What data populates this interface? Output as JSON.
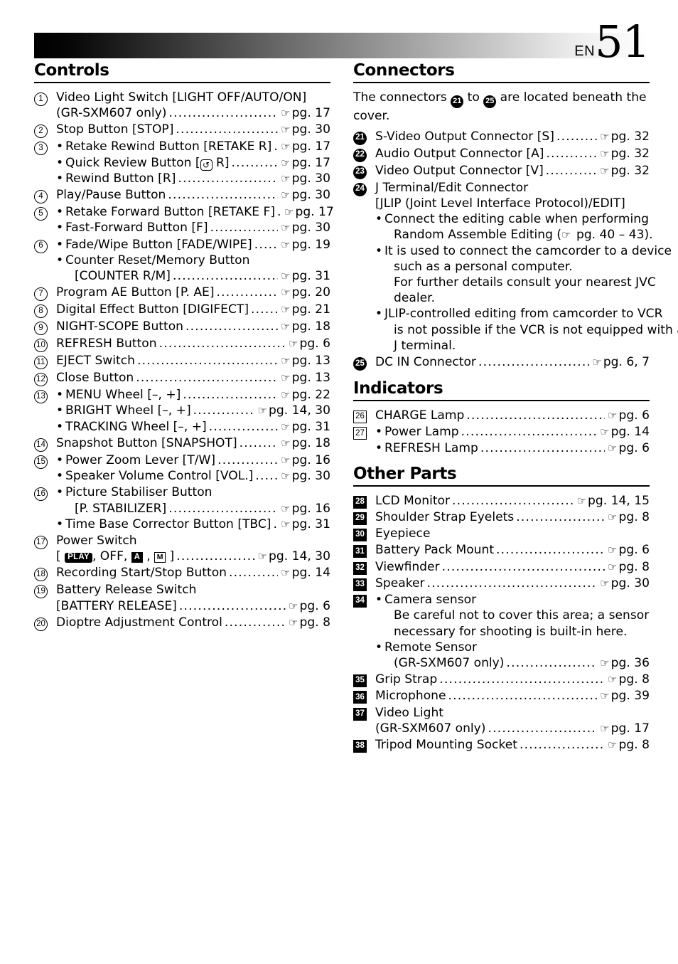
{
  "header": {
    "lang_code": "EN",
    "page_number": "51"
  },
  "icons": {
    "reference_hand": "☞",
    "bullet": "•",
    "quick_review": "↺"
  },
  "left_column": {
    "section_title": "Controls",
    "items": [
      {
        "marker": "1",
        "lines": [
          {
            "text": "Video Light Switch [LIGHT OFF/AUTO/ON]",
            "ref": ""
          },
          {
            "text": "(GR-SXM607 only)",
            "ref": "pg. 17"
          }
        ]
      },
      {
        "marker": "2",
        "lines": [
          {
            "text": "Stop Button [STOP]",
            "ref": "pg. 30"
          }
        ]
      },
      {
        "marker": "3",
        "lines": [
          {
            "bullet": true,
            "text": "Retake Rewind Button [RETAKE R]",
            "ref": "pg. 17"
          },
          {
            "bullet": true,
            "text": "Quick Review Button [",
            "text_after": " R]",
            "icon": "quick_review",
            "ref": "pg. 17"
          },
          {
            "bullet": true,
            "text": "Rewind Button [R]",
            "ref": "pg. 30"
          }
        ]
      },
      {
        "marker": "4",
        "lines": [
          {
            "text": "Play/Pause Button",
            "ref": "pg. 30"
          }
        ]
      },
      {
        "marker": "5",
        "lines": [
          {
            "bullet": true,
            "text": "Retake Forward Button [RETAKE F]",
            "ref": "pg. 17"
          },
          {
            "bullet": true,
            "text": "Fast-Forward Button [F]",
            "ref": "pg. 30"
          }
        ]
      },
      {
        "marker": "6",
        "lines": [
          {
            "bullet": true,
            "text": "Fade/Wipe Button [FADE/WIPE]",
            "ref": "pg. 19"
          },
          {
            "bullet": true,
            "text": "Counter Reset/Memory Button",
            "ref": ""
          },
          {
            "indent": 2,
            "text": "[COUNTER R/M]",
            "ref": "pg. 31"
          }
        ]
      },
      {
        "marker": "7",
        "lines": [
          {
            "text": "Program AE Button [P. AE]",
            "ref": "pg. 20"
          }
        ]
      },
      {
        "marker": "8",
        "lines": [
          {
            "text": "Digital Effect Button [DIGIFECT]",
            "ref": "pg. 21"
          }
        ]
      },
      {
        "marker": "9",
        "lines": [
          {
            "text": "NIGHT-SCOPE Button",
            "ref": "pg. 18"
          }
        ]
      },
      {
        "marker": "10",
        "lines": [
          {
            "text": "REFRESH Button",
            "ref": "pg. 6"
          }
        ]
      },
      {
        "marker": "11",
        "lines": [
          {
            "text": "EJECT Switch",
            "ref": "pg. 13"
          }
        ]
      },
      {
        "marker": "12",
        "lines": [
          {
            "text": "Close Button",
            "ref": "pg. 13"
          }
        ]
      },
      {
        "marker": "13",
        "lines": [
          {
            "bullet": true,
            "text": "MENU Wheel [–, +]",
            "ref": "pg. 22"
          },
          {
            "bullet": true,
            "text": "BRIGHT Wheel [–, +]",
            "ref": "pg. 14, 30"
          },
          {
            "bullet": true,
            "text": "TRACKING Wheel [–, +]",
            "ref": "pg. 31"
          }
        ]
      },
      {
        "marker": "14",
        "lines": [
          {
            "text": "Snapshot Button [SNAPSHOT]",
            "ref": "pg. 18"
          }
        ]
      },
      {
        "marker": "15",
        "lines": [
          {
            "bullet": true,
            "text": "Power Zoom Lever [T/W]",
            "ref": "pg. 16"
          },
          {
            "bullet": true,
            "text": "Speaker Volume Control [VOL.]",
            "ref": "pg. 30"
          }
        ]
      },
      {
        "marker": "16",
        "lines": [
          {
            "bullet": true,
            "text": "Picture Stabiliser Button",
            "ref": ""
          },
          {
            "indent": 2,
            "text": "[P. STABILIZER]",
            "ref": "pg. 16"
          },
          {
            "bullet": true,
            "text": "Time Base Corrector Button [TBC]",
            "ref": "pg. 31"
          }
        ]
      },
      {
        "marker": "17",
        "lines": [
          {
            "text": "Power Switch",
            "ref": ""
          },
          {
            "badges": true,
            "badge_play": "PLAY",
            "badge_off": ", OFF, ",
            "badge_a": "A",
            "badge_m": "M",
            "ref": "pg. 14, 30"
          }
        ]
      },
      {
        "marker": "18",
        "lines": [
          {
            "text": "Recording Start/Stop Button",
            "ref": "pg. 14"
          }
        ]
      },
      {
        "marker": "19",
        "lines": [
          {
            "text": "Battery Release Switch",
            "ref": ""
          },
          {
            "text": "[BATTERY RELEASE]",
            "ref": "pg. 6"
          }
        ]
      },
      {
        "marker": "20",
        "lines": [
          {
            "text": "Dioptre Adjustment Control",
            "ref": "pg. 8"
          }
        ]
      }
    ]
  },
  "right_column": {
    "connectors": {
      "section_title": "Connectors",
      "intro_a": "The connectors ",
      "intro_b": " to ",
      "intro_c": " are located beneath the",
      "intro_d": "cover.",
      "intro_first": "21",
      "intro_last": "25",
      "items": [
        {
          "marker": "21",
          "lines": [
            {
              "text": "S-Video Output Connector [S]",
              "ref": "pg. 32"
            }
          ]
        },
        {
          "marker": "22",
          "lines": [
            {
              "text": "Audio Output Connector [A]",
              "ref": "pg. 32"
            }
          ]
        },
        {
          "marker": "23",
          "lines": [
            {
              "text": "Video Output Connector [V]",
              "ref": "pg. 32"
            }
          ]
        },
        {
          "marker": "24",
          "lines": [
            {
              "text": "J Terminal/Edit Connector",
              "ref": ""
            },
            {
              "text": "[JLIP (Joint Level Interface Protocol)/EDIT]",
              "ref": ""
            },
            {
              "bullet": true,
              "text": "Connect the editing cable when performing",
              "ref": ""
            },
            {
              "indent": 2,
              "text": "Random Assemble Editing (",
              "text_after": " pg. 40 – 43).",
              "inline_hand": true,
              "ref": ""
            },
            {
              "bullet": true,
              "text": "It is used to connect the camcorder to a device",
              "ref": ""
            },
            {
              "indent": 2,
              "text": "such as a personal computer.",
              "ref": ""
            },
            {
              "indent": 2,
              "text": "For further details consult your nearest JVC",
              "ref": ""
            },
            {
              "indent": 2,
              "text": "dealer.",
              "ref": ""
            },
            {
              "bullet": true,
              "text": "JLIP-controlled editing from camcorder to VCR",
              "ref": ""
            },
            {
              "indent": 2,
              "text": "is not possible if the VCR is not equipped with a",
              "ref": ""
            },
            {
              "indent": 2,
              "text": "J terminal.",
              "ref": ""
            }
          ]
        },
        {
          "marker": "25",
          "lines": [
            {
              "text": "DC IN Connector",
              "ref": "pg. 6, 7"
            }
          ]
        }
      ]
    },
    "indicators": {
      "section_title": "Indicators",
      "items": [
        {
          "marker": "26",
          "lines": [
            {
              "text": "CHARGE Lamp",
              "ref": "pg. 6"
            }
          ]
        },
        {
          "marker": "27",
          "lines": [
            {
              "bullet": true,
              "text": "Power Lamp",
              "ref": "pg. 14"
            },
            {
              "bullet": true,
              "text": "REFRESH Lamp",
              "ref": "pg. 6"
            }
          ]
        }
      ]
    },
    "other_parts": {
      "section_title": "Other Parts",
      "items": [
        {
          "marker": "28",
          "lines": [
            {
              "text": "LCD Monitor",
              "ref": "pg. 14, 15"
            }
          ]
        },
        {
          "marker": "29",
          "lines": [
            {
              "text": "Shoulder Strap Eyelets",
              "ref": "pg. 8"
            }
          ]
        },
        {
          "marker": "30",
          "lines": [
            {
              "text": "Eyepiece",
              "ref": ""
            }
          ]
        },
        {
          "marker": "31",
          "lines": [
            {
              "text": "Battery Pack Mount",
              "ref": "pg. 6"
            }
          ]
        },
        {
          "marker": "32",
          "lines": [
            {
              "text": "Viewfinder",
              "ref": "pg. 8"
            }
          ]
        },
        {
          "marker": "33",
          "lines": [
            {
              "text": "Speaker",
              "ref": "pg. 30"
            }
          ]
        },
        {
          "marker": "34",
          "lines": [
            {
              "bullet": true,
              "text": "Camera sensor",
              "ref": ""
            },
            {
              "indent": 2,
              "text": "Be careful not to cover this area; a sensor",
              "ref": ""
            },
            {
              "indent": 2,
              "text": "necessary for shooting is built-in here.",
              "ref": ""
            },
            {
              "bullet": true,
              "text": "Remote Sensor",
              "ref": ""
            },
            {
              "indent": 2,
              "text": "(GR-SXM607 only)",
              "ref": "pg. 36"
            }
          ]
        },
        {
          "marker": "35",
          "lines": [
            {
              "text": "Grip Strap",
              "ref": "pg. 8"
            }
          ]
        },
        {
          "marker": "36",
          "lines": [
            {
              "text": "Microphone",
              "ref": "pg. 39"
            }
          ]
        },
        {
          "marker": "37",
          "lines": [
            {
              "text": "Video Light",
              "ref": ""
            },
            {
              "text": "(GR-SXM607 only)",
              "ref": "pg. 17"
            }
          ]
        },
        {
          "marker": "38",
          "lines": [
            {
              "text": "Tripod Mounting Socket",
              "ref": "pg. 8"
            }
          ]
        }
      ]
    }
  }
}
